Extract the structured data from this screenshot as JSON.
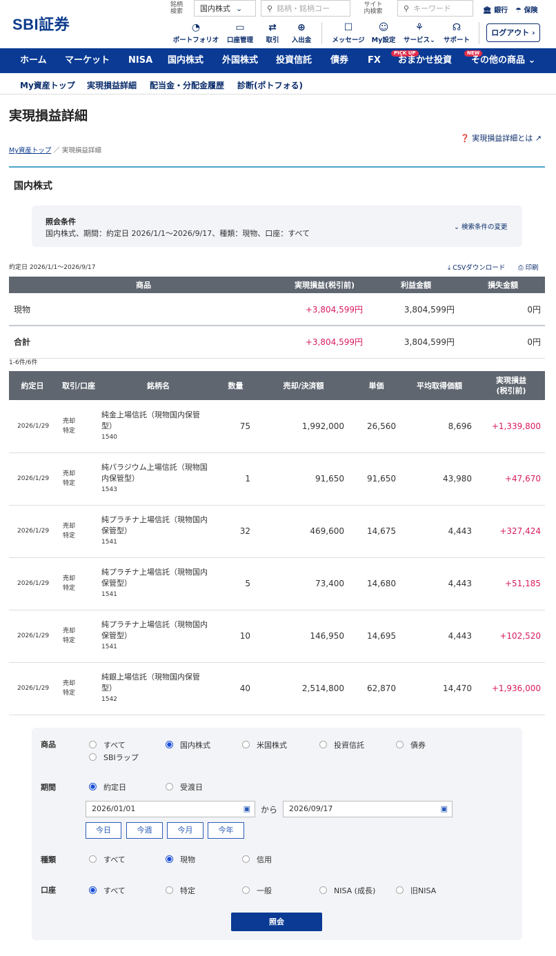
{
  "header": {
    "logo": "SBI証券",
    "stock_search_label": "銘柄\n検索",
    "market_select": "国内株式",
    "stock_search_placeholder": "銘柄・銘柄コー",
    "site_search_label": "サイト\n内検索",
    "site_search_placeholder": "キーワード",
    "bank_link": "銀行",
    "insurance_link": "保険",
    "portfolio": "ポートフォリオ",
    "account": "口座管理",
    "trade": "取引",
    "deposit": "入出金",
    "message": "メッセージ",
    "my_settings": "My設定",
    "services": "サービス",
    "support": "サポート",
    "logout": "ログアウト"
  },
  "main_nav": {
    "items": [
      "ホーム",
      "マーケット",
      "NISA",
      "国内株式",
      "外国株式",
      "投資信託",
      "債券",
      "FX",
      "おまかせ投資",
      "その他の商品"
    ],
    "pickup_badge": "PICK UP",
    "new_badge": "NEW"
  },
  "sub_nav": {
    "items": [
      "My資産トップ",
      "実現損益詳細",
      "配当金・分配金履歴",
      "診断(ポトフォる)"
    ]
  },
  "page": {
    "title": "実現損益詳細",
    "help_link": "実現損益詳細とは",
    "breadcrumb_home": "My資産トップ",
    "breadcrumb_sep": "／",
    "breadcrumb_current": "実現損益詳細",
    "section_title": "国内株式"
  },
  "conditions": {
    "heading": "照会条件",
    "text": "国内株式、期間：約定日 2026/1/1〜2026/9/17、種類：現物、口座：すべて",
    "change_link": "検索条件の変更"
  },
  "summary": {
    "period_label": "約定日 2026/1/1〜2026/9/17",
    "csv_link": "CSVダウンロード",
    "print_link": "印刷",
    "headers": [
      "商品",
      "実現損益(税引前)",
      "利益金額",
      "損失金額"
    ],
    "rows": [
      {
        "product": "現物",
        "pl": "+3,804,599円",
        "profit": "3,804,599円",
        "loss": "0円"
      }
    ],
    "total": {
      "label": "合計",
      "pl": "+3,804,599円",
      "profit": "3,804,599円",
      "loss": "0円"
    },
    "count": "1-6件/6件"
  },
  "detail": {
    "headers": [
      "約定日",
      "取引/口座",
      "銘柄名",
      "数量",
      "売却/決済額",
      "単価",
      "平均取得価額",
      "実現損益\n(税引前)"
    ],
    "rows": [
      {
        "date": "2026/1/29",
        "trade": "売却",
        "acct": "特定",
        "name": "純金上場信託（現物国内保管型）",
        "code": "1540",
        "qty": "75",
        "amount": "1,992,000",
        "price": "26,560",
        "avg": "8,696",
        "pl": "+1,339,800"
      },
      {
        "date": "2026/1/29",
        "trade": "売却",
        "acct": "特定",
        "name": "純パラジウム上場信託（現物国内保管型）",
        "code": "1543",
        "qty": "1",
        "amount": "91,650",
        "price": "91,650",
        "avg": "43,980",
        "pl": "+47,670"
      },
      {
        "date": "2026/1/29",
        "trade": "売却",
        "acct": "特定",
        "name": "純プラチナ上場信託（現物国内保管型）",
        "code": "1541",
        "qty": "32",
        "amount": "469,600",
        "price": "14,675",
        "avg": "4,443",
        "pl": "+327,424"
      },
      {
        "date": "2026/1/29",
        "trade": "売却",
        "acct": "特定",
        "name": "純プラチナ上場信託（現物国内保管型）",
        "code": "1541",
        "qty": "5",
        "amount": "73,400",
        "price": "14,680",
        "avg": "4,443",
        "pl": "+51,185"
      },
      {
        "date": "2026/1/29",
        "trade": "売却",
        "acct": "特定",
        "name": "純プラチナ上場信託（現物国内保管型）",
        "code": "1541",
        "qty": "10",
        "amount": "146,950",
        "price": "14,695",
        "avg": "4,443",
        "pl": "+102,520"
      },
      {
        "date": "2026/1/29",
        "trade": "売却",
        "acct": "特定",
        "name": "純銀上場信託（現物国内保管型）",
        "code": "1542",
        "qty": "40",
        "amount": "2,514,800",
        "price": "62,870",
        "avg": "14,470",
        "pl": "+1,936,000"
      }
    ]
  },
  "form": {
    "product_label": "商品",
    "product_options": [
      "すべて",
      "国内株式",
      "米国株式",
      "投資信託",
      "債券",
      "SBIラップ"
    ],
    "product_selected": "国内株式",
    "period_label": "期間",
    "period_options": [
      "約定日",
      "受渡日"
    ],
    "period_selected": "約定日",
    "date_from": "2026/01/01",
    "date_sep": "から",
    "date_to": "2026/09/17",
    "quick_buttons": [
      "今日",
      "今週",
      "今月",
      "今年"
    ],
    "type_label": "種類",
    "type_options": [
      "すべて",
      "現物",
      "信用"
    ],
    "type_selected": "現物",
    "account_label": "口座",
    "account_options": [
      "すべて",
      "特定",
      "一般",
      "NISA (成長)",
      "旧NISA"
    ],
    "account_selected": "すべて",
    "submit": "照会"
  },
  "colors": {
    "navy": "#0a3a94",
    "positive": "#d81b60",
    "table_header": "#5f6670"
  }
}
